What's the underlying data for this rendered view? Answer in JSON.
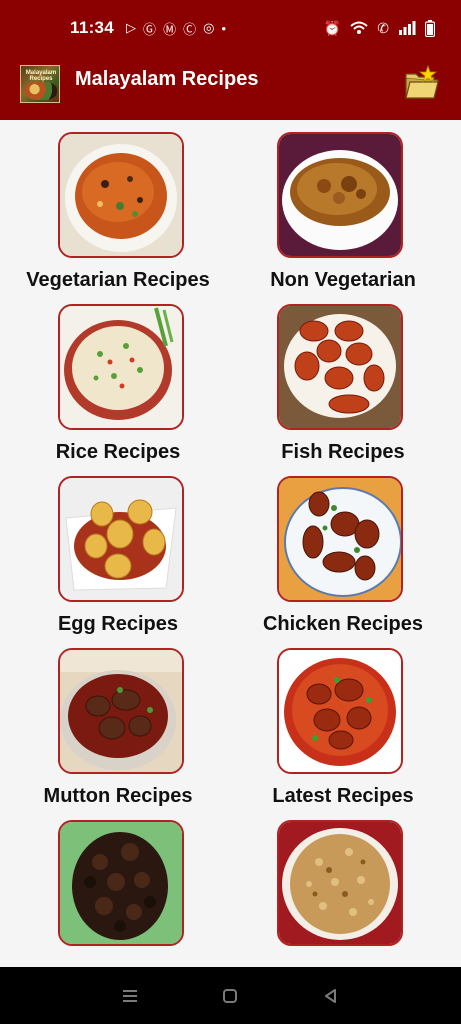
{
  "status": {
    "time": "11:34",
    "left_icons": [
      "play-icon",
      "g-icon",
      "m-icon",
      "c-icon",
      "messenger-icon",
      "dot-icon"
    ],
    "right_icons": [
      "alarm-icon",
      "wifi-icon",
      "call-icon",
      "signal-icon",
      "battery-icon"
    ]
  },
  "app_bar": {
    "title": "Malayalam Recipes",
    "logo_text": "Malayalam Recipes",
    "action_icon": "folder-icon"
  },
  "categories": [
    {
      "label": "Vegetarian Recipes",
      "image": "vegetarian-dish"
    },
    {
      "label": "Non Vegetarian",
      "image": "non-veg-curry"
    },
    {
      "label": "Rice Recipes",
      "image": "rice-dish"
    },
    {
      "label": "Fish Recipes",
      "image": "fish-fry"
    },
    {
      "label": "Egg Recipes",
      "image": "egg-roast"
    },
    {
      "label": "Chicken Recipes",
      "image": "chicken-dish"
    },
    {
      "label": "Mutton Recipes",
      "image": "mutton-curry"
    },
    {
      "label": "Latest Recipes",
      "image": "latest-curry"
    },
    {
      "label": "",
      "image": "beef-fry"
    },
    {
      "label": "",
      "image": "biryani"
    }
  ],
  "nav": [
    "recents-icon",
    "home-icon",
    "back-icon"
  ],
  "colors": {
    "primary": "#8b0000",
    "tile_border": "#b22222",
    "background": "#f5f5f5"
  }
}
